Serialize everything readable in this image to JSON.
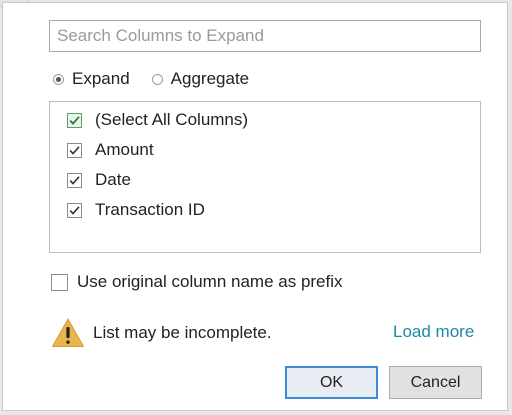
{
  "search": {
    "placeholder": "Search Columns to Expand",
    "value": ""
  },
  "mode": {
    "options": [
      {
        "label": "Expand",
        "selected": true
      },
      {
        "label": "Aggregate",
        "selected": false
      }
    ]
  },
  "columns": {
    "items": [
      {
        "label": "(Select All Columns)",
        "checked": true
      },
      {
        "label": "Amount",
        "checked": true
      },
      {
        "label": "Date",
        "checked": true
      },
      {
        "label": "Transaction ID",
        "checked": true
      }
    ]
  },
  "prefix": {
    "label": "Use original column name as prefix",
    "checked": false
  },
  "warning": {
    "text": "List may be incomplete.",
    "icon": "warning-icon",
    "color": "#e8b54d"
  },
  "load_more": {
    "label": "Load more",
    "color": "#1f88a8"
  },
  "buttons": {
    "ok_label": "OK",
    "cancel_label": "Cancel",
    "focus_color": "#3c8dd8"
  }
}
